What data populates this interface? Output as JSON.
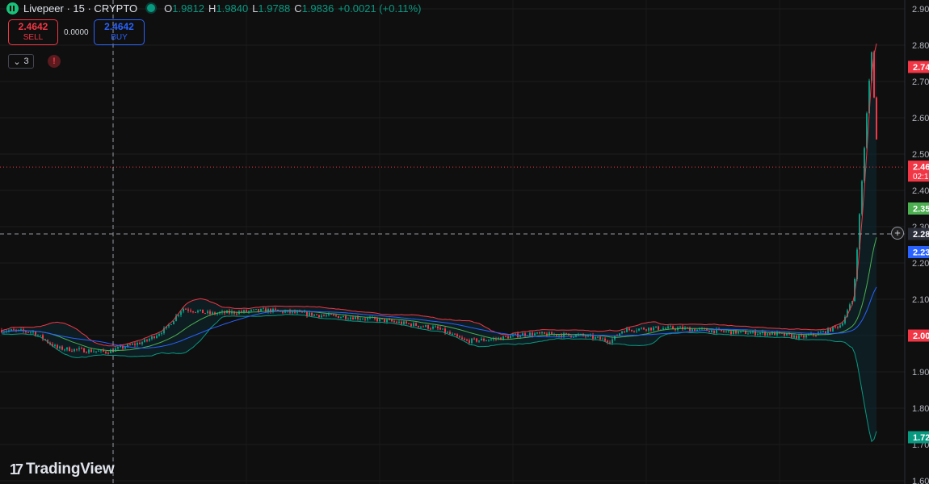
{
  "header": {
    "title": "Livepeer · 15 · CRYPTO",
    "open_label": "O",
    "open": "1.9812",
    "high_label": "H",
    "high": "1.9840",
    "low_label": "L",
    "low": "1.9788",
    "close_label": "C",
    "close": "1.9836",
    "change": "+0.0021 (+0.11%)"
  },
  "trade": {
    "sell_price": "2.4642",
    "sell_label": "SELL",
    "spread": "0.0000",
    "buy_price": "2.4642",
    "buy_label": "BUY"
  },
  "indicators": {
    "count": "3",
    "alert_glyph": "!"
  },
  "watermark": "TradingView",
  "chart_data": {
    "type": "candlestick",
    "yaxis": {
      "min": 1.6,
      "max": 2.9,
      "ticks": [
        "2.90",
        "2.80",
        "2.70",
        "2.60",
        "2.50",
        "2.40",
        "2.30",
        "2.20",
        "2.10",
        "2.00",
        "1.90",
        "1.80",
        "1.70",
        "1.60"
      ]
    },
    "price_labels": [
      {
        "text": "2.74",
        "value": 2.74,
        "color": "#f23645"
      },
      {
        "text": "2.46",
        "subtext": "02:1",
        "value": 2.4642,
        "color": "#f23645"
      },
      {
        "text": "2.35",
        "value": 2.35,
        "color": "#4caf50"
      },
      {
        "text": "2.28",
        "value": 2.28,
        "color": "#2a2e39"
      },
      {
        "text": "2.23",
        "value": 2.23,
        "color": "#2962ff"
      },
      {
        "text": "2.00",
        "value": 2.0,
        "color": "#f23645"
      },
      {
        "text": "1.72",
        "value": 1.72,
        "color": "#089981"
      }
    ],
    "current_price": 2.4642,
    "crosshair_price": 2.28,
    "colors": {
      "up": "#089981",
      "down": "#f23645",
      "ma": "#2962ff",
      "band_upper": "#f23645",
      "band_lower": "#089981",
      "band_mid": "#4caf50",
      "band_fill": "#0d2a33"
    }
  }
}
